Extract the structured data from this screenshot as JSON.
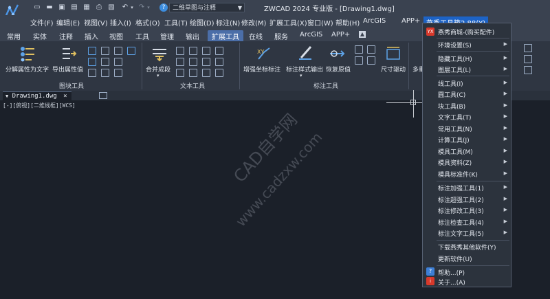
{
  "title_bar": {
    "workspace": "二维草图与注释",
    "app_title": "ZWCAD 2024 专业版 - [Drawing1.dwg]"
  },
  "menu": [
    "文件(F)",
    "编辑(E)",
    "视图(V)",
    "插入(I)",
    "格式(O)",
    "工具(T)",
    "绘图(D)",
    "标注(N)",
    "修改(M)",
    "扩展工具(X)",
    "窗口(W)",
    "帮助(H)",
    "ArcGIS",
    "APP+",
    "燕秀工具箱2.88(Y)"
  ],
  "tabs": [
    "常用",
    "实体",
    "注释",
    "插入",
    "视图",
    "工具",
    "管理",
    "输出",
    "扩展工具",
    "在线",
    "服务",
    "ArcGIS",
    "APP+"
  ],
  "ribbon": {
    "buttons": {
      "split_attr": "分解属性为文字",
      "export_attr": "导出属性值",
      "merge_para": "合并成段",
      "coord_dim": "增强坐标标注",
      "dim_style_out": "标注样式输出",
      "restore_value": "恢复原值",
      "dim_drive": "尺寸驱动",
      "partial": "多重"
    },
    "panels": {
      "block_tools": "图块工具",
      "text_tools": "文本工具",
      "dim_tools": "标注工具"
    }
  },
  "document": {
    "tab": "Drawing1.dwg",
    "viewport_label": "[-][俯视][二维线框][WCS]"
  },
  "watermark": {
    "line1": "CAD自学网",
    "line2": "www.cadzxw.com"
  },
  "dropdown": {
    "items": [
      {
        "label": "燕秀商城-(购买配件)",
        "arrow": false,
        "icon": "yx"
      },
      {
        "label": "环境设置(S)",
        "arrow": true
      },
      {
        "label": "隐藏工具(H)",
        "arrow": true
      },
      {
        "label": "图层工具(L)",
        "arrow": true
      },
      {
        "label": "线工具(I)",
        "arrow": true
      },
      {
        "label": "圆工具(C)",
        "arrow": true
      },
      {
        "label": "块工具(B)",
        "arrow": true
      },
      {
        "label": "文字工具(T)",
        "arrow": true
      },
      {
        "label": "常用工具(N)",
        "arrow": true
      },
      {
        "label": "计算工具(J)",
        "arrow": true
      },
      {
        "label": "模具工具(M)",
        "arrow": true
      },
      {
        "label": "模具资料(Z)",
        "arrow": true
      },
      {
        "label": "模具标准件(K)",
        "arrow": true
      },
      {
        "label": "标注加强工具(1)",
        "arrow": true
      },
      {
        "label": "标注超强工具(2)",
        "arrow": true
      },
      {
        "label": "标注修改工具(3)",
        "arrow": true
      },
      {
        "label": "标注检查工具(4)",
        "arrow": true
      },
      {
        "label": "标注文字工具(5)",
        "arrow": true
      },
      {
        "label": "下载燕秀其他软件(Y)",
        "arrow": false
      },
      {
        "label": "更新软件(U)",
        "arrow": false
      },
      {
        "label": "帮助...(P)",
        "arrow": false,
        "icon": "help"
      },
      {
        "label": "关于...(A)",
        "arrow": false,
        "icon": "about"
      }
    ]
  },
  "colors": {
    "accent": "#1d63c6",
    "background": "#1b2029",
    "menubar": "#3a4250"
  }
}
